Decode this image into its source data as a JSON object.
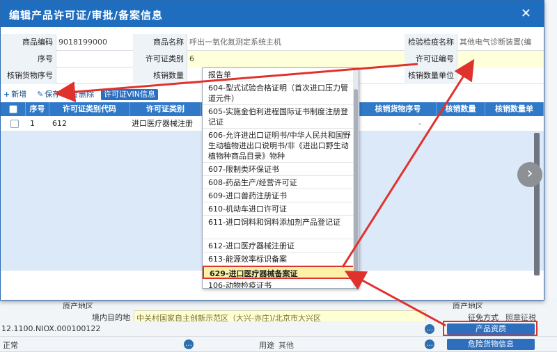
{
  "dialog": {
    "title": "编辑产品许可证/审批/备案信息",
    "close_glyph": "✕",
    "fields": {
      "commodity_code_label": "商品编码",
      "commodity_code_value": "9018199000",
      "commodity_name_label": "商品名称",
      "commodity_name_value": "呼出一氧化氮测定系统主机",
      "inspection_name_label": "检验检疫名称",
      "inspection_name_value": "其他电气诊断装置(编",
      "seq_label": "序号",
      "license_type_label": "许可证类别",
      "license_type_value": "6",
      "license_no_label": "许可证编号",
      "writeoff_goods_seq_label": "核销货物序号",
      "writeoff_qty_label": "核销数量",
      "writeoff_qty_unit_label": "核销数量单位"
    },
    "toolbar": {
      "new_label": "新增",
      "save_label": "保存",
      "delete_label": "删除",
      "vin_label": "许可证VIN信息"
    },
    "table": {
      "headers": [
        "序号",
        "许可证类别代码",
        "许可证类别",
        "",
        "核销货物序号",
        "核销数量",
        "核销数量单"
      ],
      "row": {
        "seq": "1",
        "code": "612",
        "type": "进口医疗器械注册",
        "dash": "-"
      }
    },
    "dropdown_items": [
      "报告单",
      "604-型式试验合格证明（首次进口压力管道元件）",
      "605-实施金伯利进程国际证书制度注册登记证",
      "606-允许进出口证明书/中华人民共和国野生动植物进出口说明书/非《进出口野生动植物种商品目录》物种",
      "607-限制类环保证书",
      "608-药品生产/经营许可证",
      "609-进口兽药注册证书",
      "610-机动车进口许可证",
      "611-进口饲料和饲料添加剂产品登记证",
      "612-进口医疗器械注册证",
      "613-能源效率标识备案",
      "629-进口医疗器械备案证",
      "106-动物检疫证书"
    ],
    "selected_index": 11,
    "next_glyph": "›"
  },
  "background": {
    "origin_region_label": "原产地区",
    "destination_label": "境内目的地",
    "destination_value": "中关村国家自主创新示范区（大兴-亦庄)/北京市大兴区",
    "code_string": "12.1100.NIOX.000100122",
    "normal_label": "正常",
    "usage_label": "用途",
    "usage_value": "其他",
    "product_info_btn": "产品资质",
    "danger_info_btn": "危险货物信息",
    "origin_region_right": "原产地区",
    "tax_method_label": "征免方式",
    "tax_method_value": "照章征税",
    "circle_glyph": "…"
  },
  "colors": {
    "title_bar": "#1e6dbf",
    "table_header": "#2f79c8",
    "highlight_red": "#e0322d",
    "input_yellow": "#ffffd9"
  }
}
